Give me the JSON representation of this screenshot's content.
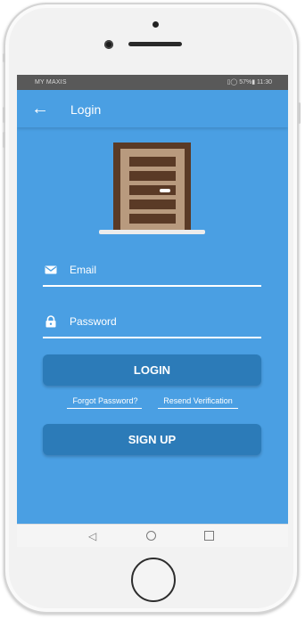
{
  "status_bar": {
    "carrier": "MY MAXIS",
    "right_text": "▯◯ 57%▮ 11:30"
  },
  "app_bar": {
    "back_icon": "arrow-left-icon",
    "title": "Login"
  },
  "illustration": {
    "icon": "door-icon",
    "colors": {
      "frame": "#5a3a26",
      "door": "#b89a7e",
      "knob": "#ffffff"
    }
  },
  "form": {
    "email": {
      "icon": "mail-icon",
      "placeholder": "Email"
    },
    "password": {
      "icon": "lock-icon",
      "placeholder": "Password"
    }
  },
  "buttons": {
    "login": "LOGIN",
    "signup": "SIGN UP"
  },
  "links": {
    "forgot_password": "Forgot Password?",
    "resend_verification": "Resend Verification"
  },
  "nav": {
    "back_icon": "triangle-back-icon",
    "home_icon": "circle-home-icon",
    "recent_icon": "square-recent-icon"
  },
  "colors": {
    "primary": "#4a9fe3",
    "button": "#2c7bb8",
    "status_bar": "#595959"
  }
}
